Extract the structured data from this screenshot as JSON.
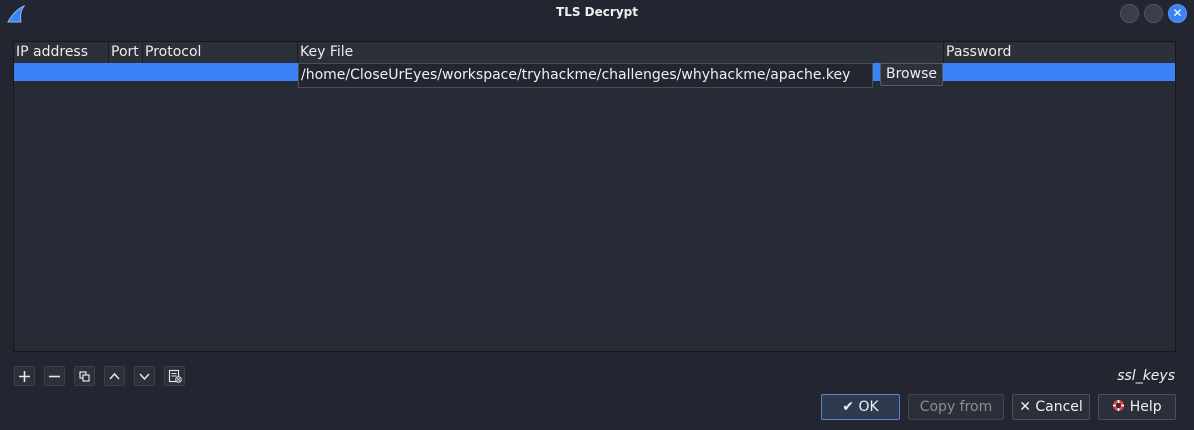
{
  "window": {
    "title": "TLS Decrypt"
  },
  "table": {
    "columns": [
      "IP address",
      "Port",
      "Protocol",
      "Key File",
      "Password"
    ],
    "rows": [
      {
        "ip": "",
        "port": "",
        "protocol": "",
        "key_file": "/home/CloseUrEyes/workspace/tryhackme/challenges/whyhackme/apache.key",
        "password": ""
      }
    ],
    "browse_label": "Browse"
  },
  "toolbar": {
    "icons": [
      "add-icon",
      "remove-icon",
      "copy-icon",
      "move-up-icon",
      "move-down-icon",
      "clear-icon"
    ]
  },
  "file_label": "ssl_keys",
  "buttons": {
    "ok": "OK",
    "copy_from": "Copy from",
    "cancel": "Cancel",
    "help": "Help"
  },
  "colors": {
    "accent": "#3b82f6",
    "background": "#232630"
  }
}
